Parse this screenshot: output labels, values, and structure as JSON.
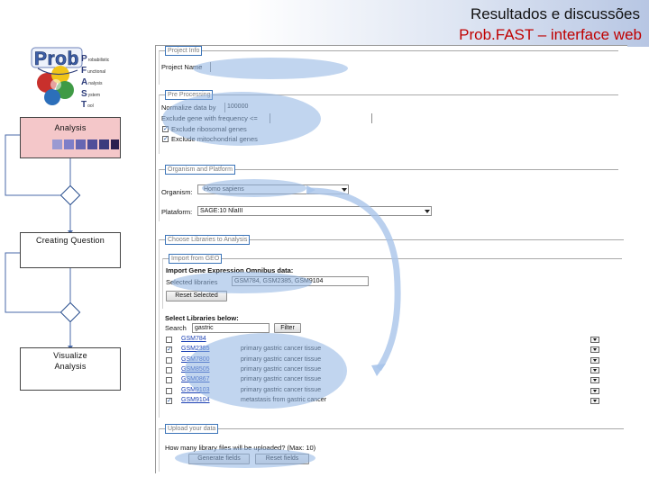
{
  "slide": {
    "title": "Resultados e discussões",
    "subtitle": "Prob.FAST – interface web"
  },
  "logo": {
    "word": "Prob",
    "lines": [
      {
        "initial": "P",
        "rest": "robabilistic"
      },
      {
        "initial": "F",
        "rest": "unctional"
      },
      {
        "initial": "A",
        "rest": "nalysis"
      },
      {
        "initial": "S",
        "rest": "ystem"
      },
      {
        "initial": "T",
        "rest": "ool"
      }
    ]
  },
  "workflow": {
    "step1": "Analysis",
    "step2": "Creating Question",
    "step3_line1": "Visualize",
    "step3_line2": "Analysis",
    "swatch_colors": [
      "#9a9ad2",
      "#7e7ec8",
      "#6666b2",
      "#4f4f9a",
      "#3b3b7d",
      "#2b1f4f"
    ]
  },
  "form": {
    "project_info": {
      "legend": "Project Info",
      "name_label": "Project Name",
      "name_value": ""
    },
    "pre_processing": {
      "legend": "Pre Processing",
      "normalize_label": "Normalize data by",
      "normalize_value": "100000",
      "exclude_freq_label": "Exclude gene with frequency <=",
      "exclude_freq_value": "",
      "exclude_ribosomal_label": "Exclude ribosomal genes",
      "exclude_ribosomal_checked": true,
      "exclude_mito_label": "Exclude mitochondrial genes",
      "exclude_mito_checked": true
    },
    "organism": {
      "legend": "Organism and Platform",
      "organism_label": "Organism:",
      "organism_value": "Homo sapiens",
      "platform_label": "Plataform:",
      "platform_value": "SAGE:10 NlaIII"
    },
    "libraries": {
      "legend": "Choose Libraries to Analysis",
      "import_legend": "Import from GEO",
      "import_title": "Import Gene Expression Omnibus data:",
      "selected_label": "Selected libraries",
      "selected_value": "GSM784, GSM2385, GSM9104",
      "reset_button": "Reset Selected",
      "select_title": "Select Libraries below:",
      "search_label": "Search",
      "search_value": "gastric",
      "filter_button": "Filter",
      "rows": [
        {
          "id": "GSM784",
          "desc": "",
          "checked": false
        },
        {
          "id": "GSM2385",
          "desc": "primary gastric cancer tissue",
          "checked": true
        },
        {
          "id": "GSM7800",
          "desc": "primary gastric cancer tissue",
          "checked": false
        },
        {
          "id": "GSM8505",
          "desc": "primary gastric cancer tissue",
          "checked": false
        },
        {
          "id": "GSM0867",
          "desc": "primary gastric cancer tissue",
          "checked": false
        },
        {
          "id": "GSM9103",
          "desc": "primary gastric cancer tissue",
          "checked": false
        },
        {
          "id": "GSM9104",
          "desc": "metastasis from gastric cancer",
          "checked": true
        }
      ]
    },
    "upload": {
      "legend": "Upload your data",
      "question": "How many library files will be uploaded? (Max: 10)",
      "generate_button": "Generate fields",
      "reset_button": "Reset fields"
    }
  }
}
